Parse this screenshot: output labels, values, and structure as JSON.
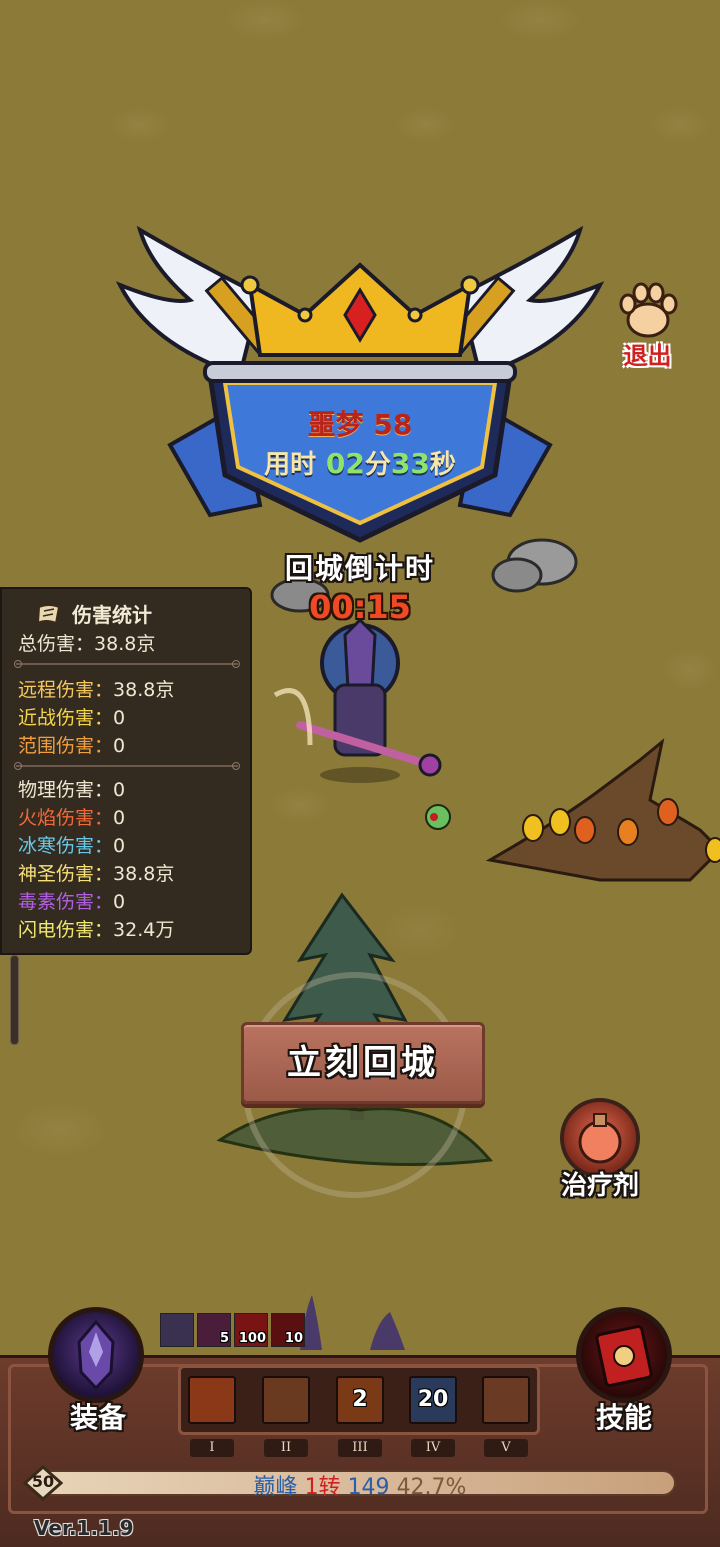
{
  "crest": {
    "difficulty": "噩梦 58",
    "time_label": "用时",
    "time_value": "02",
    "time_unit_min": "分",
    "time_sec": "33",
    "time_unit_sec": "秒"
  },
  "exit": {
    "label": "退出"
  },
  "countdown": {
    "label": "回城倒计时",
    "value": "00:15"
  },
  "damage_panel": {
    "title": "伤害统计",
    "rows": [
      {
        "label": "总伤害：",
        "value": "38.8京",
        "color": "#f0e6d2"
      },
      {
        "label": "远程伤害：",
        "value": "38.8京",
        "color": "#f6c860"
      },
      {
        "label": "近战伤害：",
        "value": "0",
        "color": "#f4d648"
      },
      {
        "label": "范围伤害：",
        "value": "0",
        "color": "#f0a040"
      },
      {
        "label": "物理伤害：",
        "value": "0",
        "color": "#f0e6d2"
      },
      {
        "label": "火焰伤害：",
        "value": "0",
        "color": "#f06a3a"
      },
      {
        "label": "冰寒伤害：",
        "value": "0",
        "color": "#6ac8e8"
      },
      {
        "label": "神圣伤害：",
        "value": "38.8京",
        "color": "#f6e07a"
      },
      {
        "label": "毒素伤害：",
        "value": "0",
        "color": "#b060e0"
      },
      {
        "label": "闪电伤害：",
        "value": "32.4万",
        "color": "#f0e870"
      }
    ]
  },
  "return_button": {
    "label": "立刻回城"
  },
  "potion": {
    "label": "治疗剂"
  },
  "buffs": [
    {
      "icon": "shadow-beast-buff-icon",
      "count": "",
      "color": "#3a3050"
    },
    {
      "icon": "dark-claw-buff-icon",
      "count": "5",
      "color": "#4a1e3a"
    },
    {
      "icon": "red-wave-buff-icon",
      "count": "100",
      "color": "#7a1414"
    },
    {
      "icon": "red-wave-buff-icon",
      "count": "10",
      "color": "#5a1010"
    }
  ],
  "bottom": {
    "equip_label": "装备",
    "skill_label": "技能",
    "slots": [
      {
        "count": "",
        "roman": "I",
        "color": "#8a3818"
      },
      {
        "count": "",
        "roman": "II",
        "color": "#6a3a20"
      },
      {
        "count": "2",
        "roman": "III",
        "color": "#7a3a18"
      },
      {
        "count": "20",
        "roman": "IV",
        "color": "#2a3a5a"
      },
      {
        "count": "",
        "roman": "V",
        "color": "#6a3a24"
      }
    ],
    "level": "50",
    "rank": "巅峰",
    "turn": "1转",
    "points": "149",
    "progress": "42.7%"
  },
  "version": "Ver.1.1.9"
}
